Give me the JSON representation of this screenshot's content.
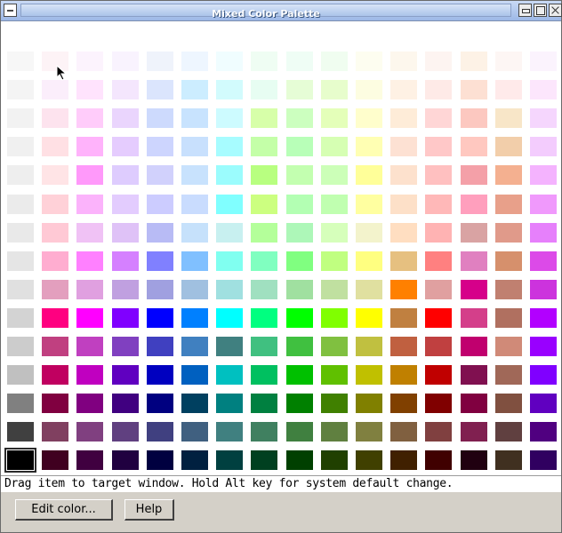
{
  "window": {
    "title": "Mixed Color Palette"
  },
  "palette": {
    "selected": [
      14,
      0
    ],
    "columns": [
      [
        "#f7f7f7",
        "#f4f4f4",
        "#f2f2f2",
        "#f0f0f0",
        "#eeeeee",
        "#ebebeb",
        "#e9e9e9",
        "#e5e5e5",
        "#e0e0e0",
        "#d3d3d3",
        "#cccccc",
        "#c0c0c0",
        "#808080",
        "#404040",
        "#000000"
      ],
      [
        "#fdf3f6",
        "#fbeefb",
        "#fde3ee",
        "#ffe0e4",
        "#ffe4e6",
        "#ffd1d8",
        "#ffc9d5",
        "#ffadd0",
        "#e39fbe",
        "#ff0080",
        "#c04080",
        "#c00060",
        "#800040",
        "#804060",
        "#400020"
      ],
      [
        "#fcf3fd",
        "#ffe3fd",
        "#ffccfa",
        "#ffb3fb",
        "#ff99fa",
        "#fbb3fb",
        "#f0c2f5",
        "#ff80ff",
        "#e0a0e0",
        "#ff00ff",
        "#c040c0",
        "#c000c0",
        "#800080",
        "#804080",
        "#400040"
      ],
      [
        "#f9f3fe",
        "#f4e6fd",
        "#ead5fd",
        "#e5ccfe",
        "#deccfe",
        "#e3ccfe",
        "#dfc2f7",
        "#d580ff",
        "#c0a0e0",
        "#8000ff",
        "#8040c0",
        "#6000c0",
        "#400080",
        "#604080",
        "#200040"
      ],
      [
        "#eff3fb",
        "#dbe5fd",
        "#cddafd",
        "#cdd5fe",
        "#d1d1fc",
        "#ccccff",
        "#b8bbf5",
        "#8080ff",
        "#a0a0e0",
        "#0000ff",
        "#4040c0",
        "#0000c0",
        "#000080",
        "#404080",
        "#000040"
      ],
      [
        "#eef6ff",
        "#ccedff",
        "#c8e3fe",
        "#c8e0fd",
        "#c8e2fd",
        "#c9dcfe",
        "#c6e1fb",
        "#80c0ff",
        "#a0c0e0",
        "#0080ff",
        "#4080c0",
        "#0060c0",
        "#004060",
        "#406080",
        "#002040"
      ],
      [
        "#f0fdff",
        "#d2fbfd",
        "#cdfbff",
        "#a7fcff",
        "#9bfcfd",
        "#80ffff",
        "#c8f0f0",
        "#80fff0",
        "#a0e0e0",
        "#00ffff",
        "#408080",
        "#00c0c0",
        "#008080",
        "#408080",
        "#004040"
      ],
      [
        "#effdf3",
        "#e7fdf2",
        "#d7ffa9",
        "#c4ffa8",
        "#b8ff80",
        "#ccff80",
        "#b4ff9a",
        "#80ffc0",
        "#a0e0c0",
        "#00ff80",
        "#40c080",
        "#00c060",
        "#008040",
        "#408060",
        "#004020"
      ],
      [
        "#effdf5",
        "#e6fdd6",
        "#ccffbf",
        "#b8ffb8",
        "#c3ffb0",
        "#b3ffb3",
        "#adf7b8",
        "#80ff80",
        "#a0e0a0",
        "#00ff00",
        "#40c040",
        "#00c000",
        "#008000",
        "#408040",
        "#004000"
      ],
      [
        "#f0fdf0",
        "#e7fdcc",
        "#e4ffb9",
        "#d6ffb3",
        "#ccffb8",
        "#c0ffb0",
        "#d6ffbb",
        "#c0ff80",
        "#c0e0a0",
        "#80ff00",
        "#80c040",
        "#60c000",
        "#408000",
        "#608040",
        "#204000"
      ],
      [
        "#fdfdf0",
        "#fdfde1",
        "#fffecc",
        "#ffffb3",
        "#ffff99",
        "#ffffa0",
        "#f3f3cc",
        "#ffff80",
        "#e0e0a0",
        "#ffff00",
        "#c0c040",
        "#c0c000",
        "#808000",
        "#808040",
        "#404000"
      ],
      [
        "#fdf7ed",
        "#fef1e4",
        "#feecd8",
        "#fde1d3",
        "#fde1cd",
        "#fde0c8",
        "#ffdec1",
        "#e6c080",
        "#ff8000",
        "#c08040",
        "#c06040",
        "#c08000",
        "#804000",
        "#806040",
        "#402000"
      ],
      [
        "#fdf4f1",
        "#feeae7",
        "#ffd6d6",
        "#ffc8c8",
        "#ffc0c0",
        "#ffb8b8",
        "#ffb3b3",
        "#ff8080",
        "#e0a0a0",
        "#ff0000",
        "#c04040",
        "#c00000",
        "#800000",
        "#804040",
        "#400000"
      ],
      [
        "#fdf2e6",
        "#fde0d3",
        "#fcc8c0",
        "#ffc8c0",
        "#f4a0a8",
        "#ff9fbd",
        "#d9a3a3",
        "#e080c0",
        "#d6008a",
        "#d43f8a",
        "#c0006e",
        "#801050",
        "#800040",
        "#802050",
        "#200010"
      ],
      [
        "#fdf6f4",
        "#ffeaea",
        "#f8e6c8",
        "#f2ceaa",
        "#f4b090",
        "#e8a08a",
        "#e09a8a",
        "#d6906c",
        "#c08070",
        "#b07060",
        "#d08a78",
        "#a06858",
        "#805040",
        "#604040",
        "#403020"
      ],
      [
        "#fbf3fd",
        "#fce6fc",
        "#f5d6fd",
        "#f3ccfd",
        "#f4b3fe",
        "#f099fc",
        "#e680fb",
        "#dc4ae8",
        "#cc33dd",
        "#b200ff",
        "#9900ff",
        "#8000ff",
        "#6000c0",
        "#500080",
        "#300060"
      ]
    ]
  },
  "status": {
    "text": "Drag item to target window.  Hold Alt key for system default change."
  },
  "buttons": {
    "edit_color": "Edit color...",
    "help": "Help"
  }
}
